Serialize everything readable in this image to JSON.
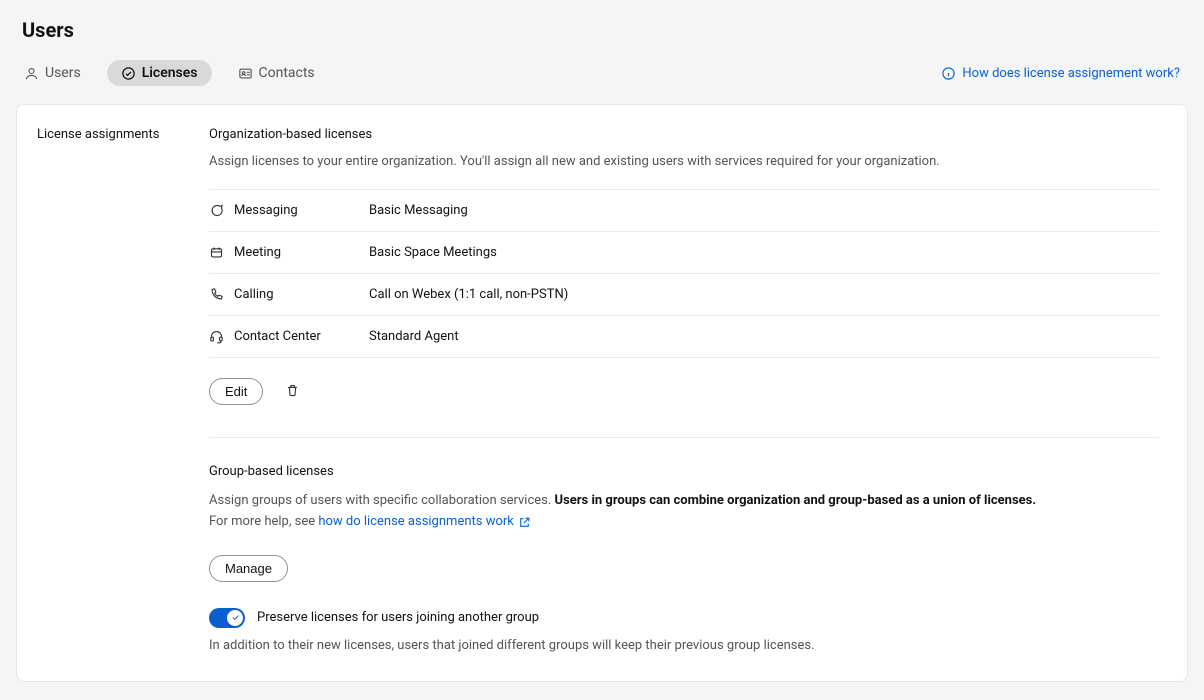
{
  "page": {
    "title": "Users"
  },
  "tabs": {
    "users": "Users",
    "licenses": "Licenses",
    "contacts": "Contacts"
  },
  "help_link": "How does license assignement work?",
  "side_heading": "License assignments",
  "org_section": {
    "title": "Organization-based licenses",
    "desc": "Assign licenses to your entire organization. You'll assign all new and existing users with services required for your organization.",
    "rows": [
      {
        "label": "Messaging",
        "value": "Basic Messaging"
      },
      {
        "label": "Meeting",
        "value": "Basic Space Meetings"
      },
      {
        "label": "Calling",
        "value": "Call on Webex (1:1 call, non-PSTN)"
      },
      {
        "label": "Contact Center",
        "value": "Standard Agent"
      }
    ],
    "edit_label": "Edit"
  },
  "group_section": {
    "title": "Group-based licenses",
    "desc_pre": "Assign groups of users with specific collaboration services. ",
    "desc_bold": "Users in groups can combine organization and group-based as a union of licenses.",
    "desc_more_pre": "For more help, see ",
    "desc_link": "how do license assignments work",
    "manage_label": "Manage",
    "toggle_label": "Preserve licenses for users joining another group",
    "toggle_helper": "In addition to their new licenses, users that joined different groups will keep their previous group licenses."
  }
}
